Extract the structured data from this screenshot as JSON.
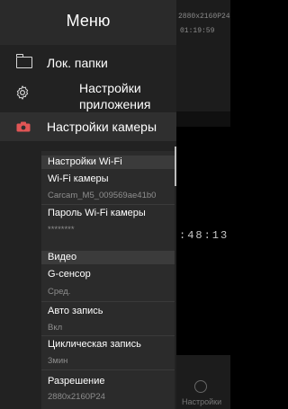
{
  "background": {
    "resolution": "2880x2160P24",
    "top_time": "01:19:59",
    "clock": ":48:13",
    "bottom_settings_label": "Настройки"
  },
  "drawer": {
    "title": "Меню",
    "items": [
      {
        "label": "Лок. папки",
        "icon": "folder-icon"
      },
      {
        "label": "Настройки приложения",
        "icon": "gear-icon"
      },
      {
        "label": "Настройки камеры",
        "icon": "camera-icon",
        "accent": "#e05555"
      }
    ]
  },
  "settings": {
    "wifi": {
      "header": "Настройки Wi-Fi",
      "ssid_label": "Wi-Fi камеры",
      "ssid_value": "Carcam_M5_009569ae41b0",
      "password_label": "Пароль Wi-Fi камеры",
      "password_value": "********"
    },
    "video": {
      "header": "Видео",
      "gsensor_label": "G-сенсор",
      "gsensor_value": "Сред.",
      "autorecord_label": "Авто запись",
      "autorecord_value": "Вкл",
      "loop_label": "Циклическая запись",
      "loop_value": "3мин",
      "resolution_label": "Разрешение",
      "resolution_value": "2880x2160P24"
    }
  }
}
